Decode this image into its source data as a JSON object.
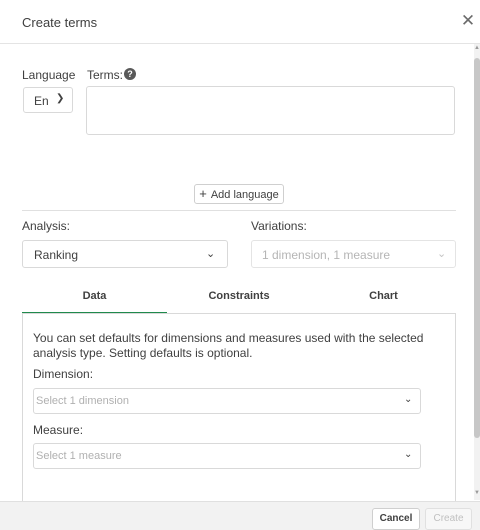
{
  "dialog": {
    "title": "Create terms",
    "close_icon": "close-icon"
  },
  "language": {
    "label": "Language",
    "selected": "En"
  },
  "terms": {
    "label": "Terms:",
    "help_icon": "question-icon",
    "value": ""
  },
  "add_language": {
    "label": "Add language"
  },
  "analysis": {
    "label": "Analysis:",
    "selected": "Ranking"
  },
  "variations": {
    "label": "Variations:",
    "selected": "1 dimension, 1 measure"
  },
  "tabs": [
    {
      "label": "Data",
      "active": true
    },
    {
      "label": "Constraints",
      "active": false
    },
    {
      "label": "Chart",
      "active": false
    }
  ],
  "data_panel": {
    "description": "You can set defaults for dimensions and measures used with the selected analysis type. Setting defaults is optional.",
    "dimension_label": "Dimension:",
    "dimension_placeholder": "Select 1 dimension",
    "measure_label": "Measure:",
    "measure_placeholder": "Select 1 measure"
  },
  "footer": {
    "cancel_label": "Cancel",
    "create_label": "Create"
  },
  "colors": {
    "active_tab_accent": "#1f8a4c",
    "text": "#404040",
    "disabled_text": "#b5b5b5"
  }
}
